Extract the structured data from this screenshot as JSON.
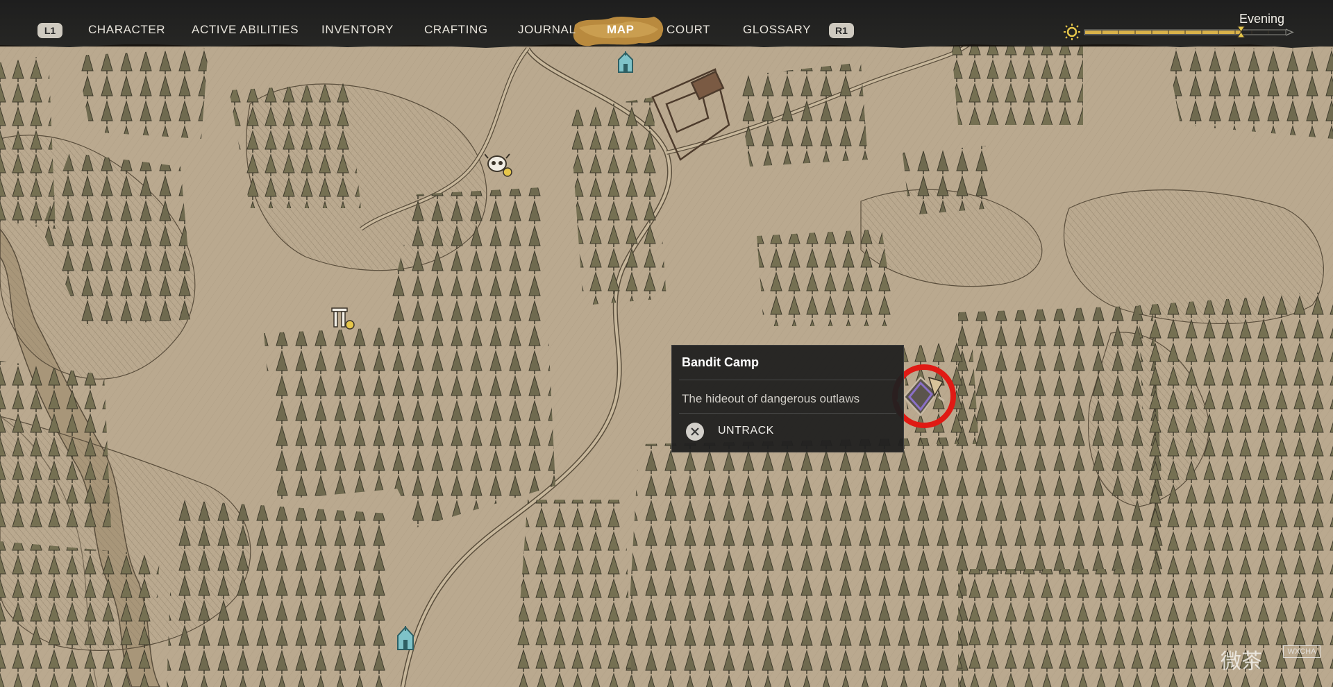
{
  "nav": {
    "left_button": "L1",
    "right_button": "R1",
    "tabs": [
      {
        "label": "CHARACTER"
      },
      {
        "label": "ACTIVE ABILITIES"
      },
      {
        "label": "INVENTORY"
      },
      {
        "label": "CRAFTING"
      },
      {
        "label": "JOURNAL"
      },
      {
        "label": "MAP"
      },
      {
        "label": "COURT"
      },
      {
        "label": "GLOSSARY"
      }
    ],
    "active_tab": "MAP"
  },
  "time_of_day": {
    "label": "Evening",
    "progress": 0.78,
    "icon": "sun-icon"
  },
  "tooltip": {
    "title": "Bandit Camp",
    "description": "The hideout of dangerous outlaws",
    "action_label": "UNTRACK",
    "action_icon": "cross-button-icon"
  },
  "markers": [
    {
      "name": "shrine-icon"
    },
    {
      "name": "skull-camp-icon"
    },
    {
      "name": "ruins-icon"
    },
    {
      "name": "bandit-camp-tracked-icon"
    },
    {
      "name": "chapel-icon"
    }
  ],
  "colors": {
    "map_paper": "#b9a88e",
    "tree": "#6f6a4f",
    "highlight_ring": "#e01a14",
    "marker_purple": "#8a6fc7"
  },
  "watermark": {
    "text": "微茶",
    "badge": "WXCHA"
  }
}
